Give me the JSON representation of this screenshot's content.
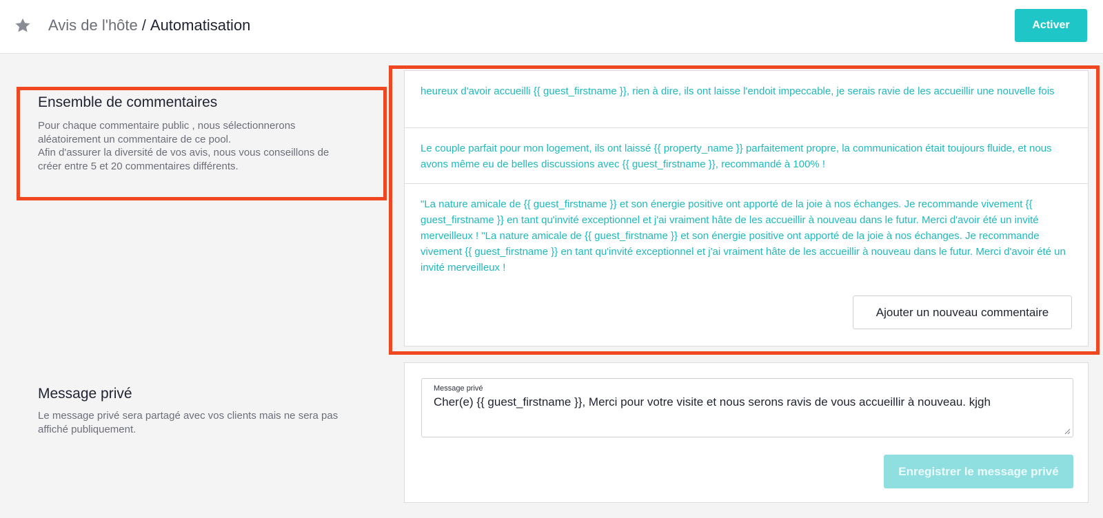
{
  "header": {
    "star_icon": "star-icon",
    "breadcrumb_parent": "Avis de l'hôte",
    "breadcrumb_separator": "/",
    "breadcrumb_current": "Automatisation",
    "activate_label": "Activer"
  },
  "comments_section": {
    "title": "Ensemble de commentaires",
    "desc_line1": "Pour chaque commentaire public , nous sélectionnerons",
    "desc_line2": "aléatoirement un commentaire de ce pool.",
    "desc_line3": "Afin d'assurer la diversité de vos avis, nous vous conseillons de",
    "desc_line4": "créer entre 5 et 20 commentaires différents.",
    "comments": [
      "heureux d'avoir accueilli {{ guest_firstname }}, rien à dire, ils ont laisse l'endoit impeccable, je serais ravie de les accueillir une nouvelle fois",
      "Le couple parfait pour mon logement, ils ont laissé {{ property_name }} parfaitement propre, la communication était toujours fluide, et nous avons même eu de belles discussions avec {{ guest_firstname }}, recommandé à 100% !",
      "\"La nature amicale de {{ guest_firstname }} et son énergie positive ont apporté de la joie à nos échanges. Je recommande vivement {{ guest_firstname }} en tant qu'invité exceptionnel et j'ai vraiment hâte de les accueillir à nouveau dans le futur. Merci d'avoir été un invité merveilleux ! \"La nature amicale de {{ guest_firstname }} et son énergie positive ont apporté de la joie à nos échanges. Je recommande vivement {{ guest_firstname }} en tant qu'invité exceptionnel et j'ai vraiment hâte de les accueillir à nouveau dans le futur. Merci d'avoir été un invité merveilleux !"
    ],
    "add_button_label": "Ajouter un nouveau commentaire"
  },
  "private_section": {
    "title": "Message privé",
    "desc_line1": "Le message privé sera partagé avec vos clients mais ne sera pas",
    "desc_line2": "affiché publiquement.",
    "field_label": "Message privé",
    "field_value": "Cher(e) {{ guest_firstname }}, Merci pour votre visite et nous serons ravis de vous accueillir à nouveau. kjgh",
    "save_button_label": "Enregistrer le message privé"
  },
  "colors": {
    "accent": "#1fc6c8",
    "comment_text": "#1fb8bc",
    "highlight": "#ee4722",
    "save_disabled": "#8fdee0"
  }
}
